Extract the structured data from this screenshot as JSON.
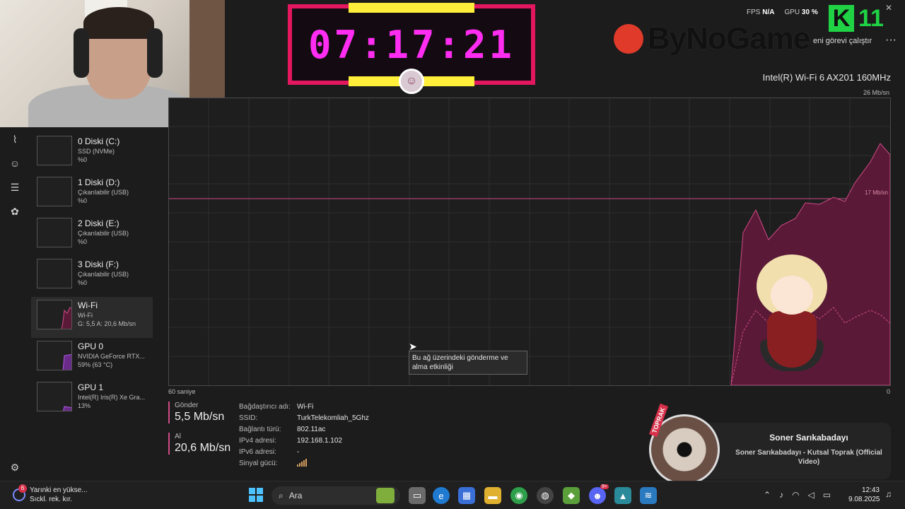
{
  "overlay": {
    "timer": "07:17:21",
    "fps_label": "FPS",
    "fps_value": "N/A",
    "gpu_label": "GPU",
    "gpu_value": "30 %",
    "brand": "ByNoGame",
    "k_logo": "K",
    "k_number": "11"
  },
  "header": {
    "run_task": "eni görevi çalıştır",
    "more": "···"
  },
  "graph": {
    "adapter_name": "Intel(R) Wi-Fi 6 AX201 160MHz",
    "scale_max": "26 Mb/sn",
    "ref_label": "17 Mb/sn",
    "x_left": "60 saniye",
    "x_right": "0",
    "tooltip": "Bu ağ üzerindeki gönderme ve alma etkinliği",
    "line_color": "#d04a86",
    "fill_color": "#5a1a37"
  },
  "resources": [
    {
      "title": "0 Diski (C:)",
      "sub": "SSD (NVMe)",
      "value": "%0"
    },
    {
      "title": "1 Diski (D:)",
      "sub": "Çıkarılabilir (USB)",
      "value": "%0"
    },
    {
      "title": "2 Diski (E:)",
      "sub": "Çıkarılabilir (USB)",
      "value": "%0"
    },
    {
      "title": "3 Diski (F:)",
      "sub": "Çıkarılabilir (USB)",
      "value": "%0"
    },
    {
      "title": "Wi-Fi",
      "sub": "Wi-Fi",
      "value": "G: 5,5 A: 20,6 Mb/sn"
    },
    {
      "title": "GPU 0",
      "sub": "NVIDIA GeForce RTX...",
      "value": "59% (63 °C)"
    },
    {
      "title": "GPU 1",
      "sub": "Intel(R) Iris(R) Xe Gra...",
      "value": "13%"
    }
  ],
  "stats": {
    "send_label": "Gönder",
    "send_value": "5,5 Mb/sn",
    "recv_label": "Al",
    "recv_value": "20,6 Mb/sn"
  },
  "details": [
    {
      "key": "Bağdaştırıcı adı:",
      "value": "Wi-Fi"
    },
    {
      "key": "SSID:",
      "value": "TurkTelekomliah_5Ghz"
    },
    {
      "key": "Bağlantı türü:",
      "value": "802.11ac"
    },
    {
      "key": "IPv4 adresi:",
      "value": "192.168.1.102"
    },
    {
      "key": "IPv6 adresi:",
      "value": "-"
    },
    {
      "key": "Sinyal gücü:",
      "value": ""
    }
  ],
  "music": {
    "tag": "TOPRAK",
    "artist": "Soner Sarıkabadayı",
    "song": "Soner Sarıkabadayı - Kutsal Toprak (Official Video)"
  },
  "taskbar": {
    "weather_line1": "Yarınki en yükse...",
    "weather_line2": "Sıckl. rek. kır.",
    "weather_badge": "6",
    "search_label": "Ara",
    "discord_badge": "9+",
    "time": "12:43",
    "date": "9.08.2025"
  }
}
